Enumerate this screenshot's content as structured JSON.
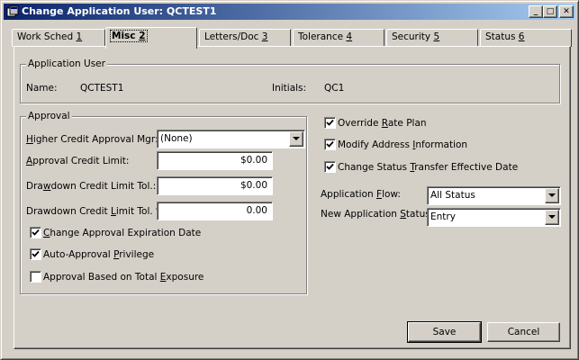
{
  "window": {
    "title": "Change Application User: QCTEST1",
    "controls": {
      "minimize": "_",
      "maximize": "□",
      "close": "✕"
    }
  },
  "tabs": [
    {
      "pre": "Work Sched ",
      "key": "1",
      "post": ""
    },
    {
      "pre": "Misc ",
      "key": "2",
      "post": "",
      "active": true
    },
    {
      "pre": "Letters/Doc ",
      "key": "3",
      "post": ""
    },
    {
      "pre": "Tolerance ",
      "key": "4",
      "post": ""
    },
    {
      "pre": "Security ",
      "key": "5",
      "post": ""
    },
    {
      "pre": "Status ",
      "key": "6",
      "post": ""
    }
  ],
  "app_user": {
    "legend": "Application User",
    "name_label": "Name:",
    "name_value": "QCTEST1",
    "initials_label": "Initials:",
    "initials_value": "QC1"
  },
  "approval": {
    "legend": "Approval",
    "higher_mgr": {
      "pre": "",
      "key": "H",
      "post": "igher Credit Approval Mgr:",
      "value": "(None)"
    },
    "credit_limit": {
      "pre": "",
      "key": "A",
      "post": "pproval Credit Limit:",
      "value": "$0.00"
    },
    "drawdown_tol": {
      "pre": "Dra",
      "key": "w",
      "post": "down Credit Limit Tol.:",
      "value": "$0.00"
    },
    "drawdown_pct": {
      "pre": "Drawdown Credit ",
      "key": "L",
      "post": "imit Tol. %:",
      "value": "0.00"
    },
    "checks": [
      {
        "pre": "",
        "key": "C",
        "post": "hange Approval Expiration Date",
        "checked": true
      },
      {
        "pre": "Auto-Approval ",
        "key": "P",
        "post": "rivilege",
        "checked": true
      },
      {
        "pre": "Approval Based on Total ",
        "key": "E",
        "post": "xposure",
        "checked": false
      }
    ]
  },
  "right": {
    "checks": [
      {
        "pre": "Override ",
        "key": "R",
        "post": "ate Plan",
        "checked": true
      },
      {
        "pre": "Modify Address ",
        "key": "I",
        "post": "nformation",
        "checked": true
      },
      {
        "pre": "Change Status ",
        "key": "T",
        "post": "ransfer Effective Date",
        "checked": true
      }
    ],
    "app_flow": {
      "pre": "Application ",
      "key": "F",
      "post": "low:",
      "value": "All Status"
    },
    "new_status": {
      "pre": "New Application ",
      "key": "S",
      "post": "tatus:",
      "value": "Entry"
    }
  },
  "buttons": {
    "save": "Save",
    "cancel": "Cancel"
  }
}
